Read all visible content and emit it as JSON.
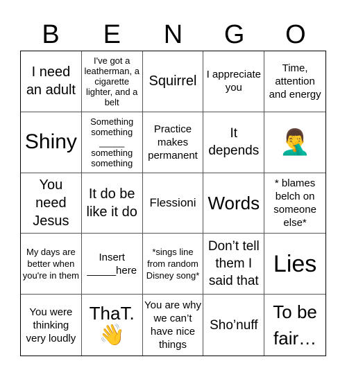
{
  "header": {
    "letters": [
      "B",
      "E",
      "N",
      "G",
      "O"
    ]
  },
  "cells": [
    {
      "text": "I need an adult"
    },
    {
      "text": "I've got a leatherman, a cigarette lighter, and a belt"
    },
    {
      "text": "Squirrel"
    },
    {
      "text": "I appreciate you"
    },
    {
      "text": "Time, attention and energy"
    },
    {
      "text": "Shiny"
    },
    {
      "text": "Something something _____ something something"
    },
    {
      "text": "Practice makes permanent"
    },
    {
      "text": "It depends"
    },
    {
      "text": "🤦‍♂️",
      "icon": "facepalm-emoji"
    },
    {
      "text": "You need Jesus"
    },
    {
      "text": "It do be like it do"
    },
    {
      "text": "Flessioni"
    },
    {
      "text": "Words"
    },
    {
      "text": "* blames belch on someone else*"
    },
    {
      "text": "My days are better when you're in them"
    },
    {
      "text": "Insert _____here"
    },
    {
      "text": "*sings line from random Disney song*"
    },
    {
      "text": "Don’t tell them I said that"
    },
    {
      "text": "Lies"
    },
    {
      "text": "You were thinking very loudly"
    },
    {
      "text": "ThaT.",
      "emoji": "👋",
      "icon": "waving-hand-emoji"
    },
    {
      "text": "You are why we can’t have nice things"
    },
    {
      "text": "Sho’nuff"
    },
    {
      "text": "To be fair…"
    }
  ]
}
